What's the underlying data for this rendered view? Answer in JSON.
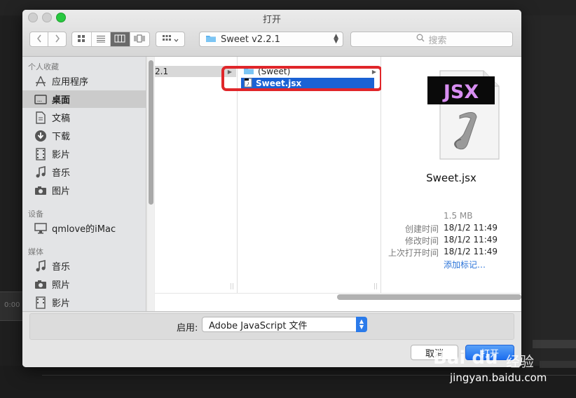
{
  "dialog": {
    "title": "打开"
  },
  "toolbar": {
    "location": "Sweet v2.2.1",
    "search_placeholder": "搜索"
  },
  "sidebar": {
    "sections": [
      {
        "header": "个人收藏",
        "items": [
          {
            "label": "应用程序",
            "icon": "applications-icon"
          },
          {
            "label": "桌面",
            "icon": "desktop-icon",
            "selected": true
          },
          {
            "label": "文稿",
            "icon": "documents-icon"
          },
          {
            "label": "下载",
            "icon": "downloads-icon"
          },
          {
            "label": "影片",
            "icon": "movies-icon"
          },
          {
            "label": "音乐",
            "icon": "music-icon"
          },
          {
            "label": "图片",
            "icon": "pictures-icon"
          }
        ]
      },
      {
        "header": "设备",
        "items": [
          {
            "label": "qmlove的iMac",
            "icon": "computer-icon"
          }
        ]
      },
      {
        "header": "媒体",
        "items": [
          {
            "label": "音乐",
            "icon": "music-icon"
          },
          {
            "label": "照片",
            "icon": "photos-icon"
          },
          {
            "label": "影片",
            "icon": "movies-icon"
          }
        ]
      }
    ]
  },
  "columns": {
    "col1_item": "2.1",
    "col2_items": [
      {
        "label": "(Sweet)",
        "type": "folder"
      },
      {
        "label": "Sweet.jsx",
        "type": "file",
        "selected": true
      }
    ]
  },
  "preview": {
    "badge": "JSX",
    "name": "Sweet.jsx",
    "size": "1.5 MB",
    "created_label": "创建时间",
    "created_value": "18/1/2 11:49",
    "modified_label": "修改时间",
    "modified_value": "18/1/2 11:49",
    "opened_label": "上次打开时间",
    "opened_value": "18/1/2 11:49",
    "add_tags": "添加标记…"
  },
  "bottom": {
    "enable_label": "启用:",
    "enable_value": "Adobe JavaScript 文件",
    "cancel_label": "取消",
    "open_label": "打开"
  },
  "background": {
    "time_text": "0:00"
  },
  "watermark": {
    "logo": "Bai du",
    "cn": "经验",
    "url": "jingyan.baidu.com"
  },
  "colors": {
    "accent": "#1a62d4",
    "highlight": "#e0262a",
    "tags_link": "#2a73d8"
  }
}
